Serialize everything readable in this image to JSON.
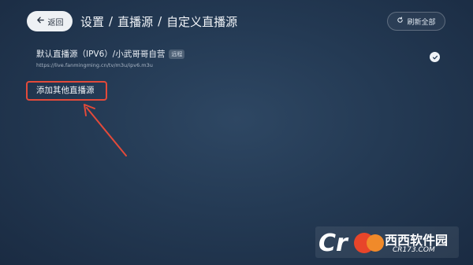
{
  "header": {
    "back_label": "返回",
    "breadcrumb": [
      "设置",
      "直播源",
      "自定义直播源"
    ],
    "separator": "/",
    "refresh_label": "刷新全部"
  },
  "sources": [
    {
      "title": "默认直播源（IPV6）/小武哥哥自营",
      "badge": "远程",
      "url": "https://live.fanmingming.cn/tv/m3u/ipv6.m3u",
      "selected": true
    }
  ],
  "add_source_label": "添加其他直播源",
  "watermark": {
    "brand": "西西软件园",
    "site": "CR173.COM"
  },
  "colors": {
    "background": "#243a54",
    "highlight": "#e34a3a",
    "button": "#eef1f4"
  }
}
